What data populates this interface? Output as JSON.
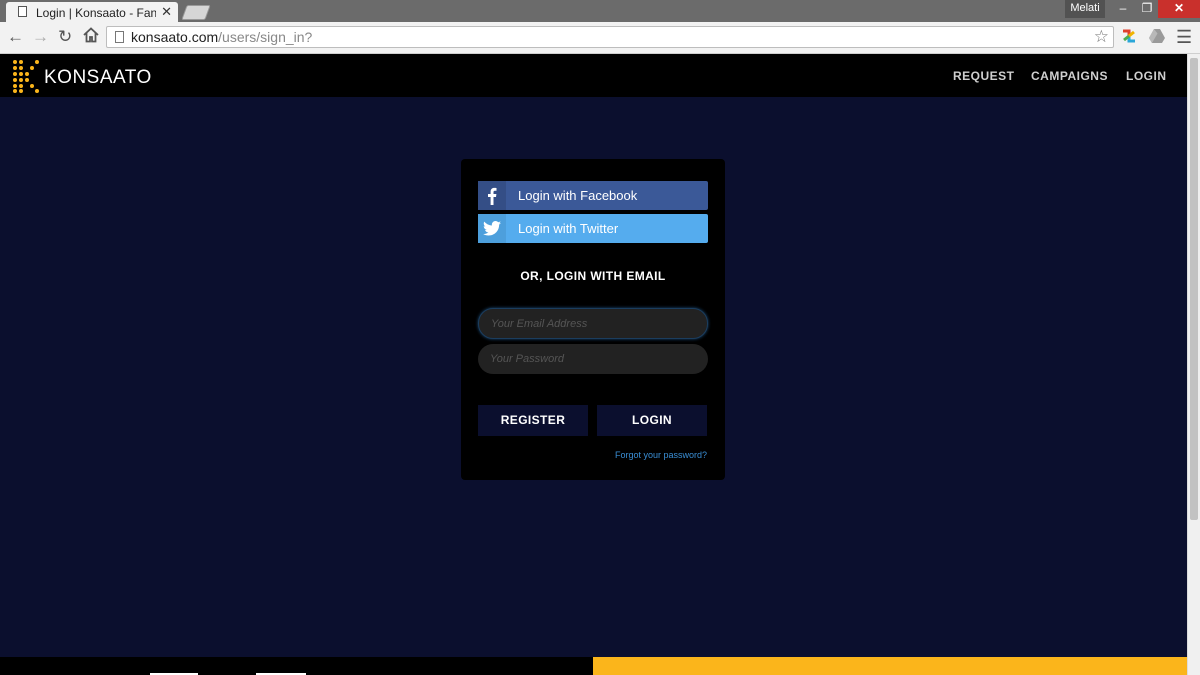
{
  "browser": {
    "tab_title": "Login | Konsaato - Fans D",
    "tab_close": "✕",
    "profile_name": "Melati",
    "url_domain": "konsaato.com",
    "url_path": "/users/sign_in?",
    "win_min": "–",
    "win_max": "❐",
    "win_close": "✕"
  },
  "site": {
    "brand": "KONSAATO",
    "nav": {
      "request": "REQUEST",
      "campaigns": "CAMPAIGNS",
      "login": "LOGIN"
    }
  },
  "login_panel": {
    "facebook_label": "Login with Facebook",
    "twitter_label": "Login with Twitter",
    "or_heading": "OR, LOGIN WITH EMAIL",
    "email_placeholder": "Your Email Address",
    "password_placeholder": "Your Password",
    "register_label": "REGISTER",
    "login_label": "LOGIN",
    "forgot_label": "Forgot your password?"
  },
  "colors": {
    "page_background": "#0b0f2e",
    "facebook": "#3b5998",
    "twitter": "#55acee",
    "brand_gold": "#fbb51b",
    "link": "#3a8fd6"
  },
  "icons": {
    "back": "arrow-left-icon",
    "forward": "arrow-right-icon",
    "reload": "reload-icon",
    "home": "home-icon",
    "bookmark": "star-icon",
    "menu": "hamburger-menu-icon",
    "facebook": "facebook-icon",
    "twitter": "twitter-icon"
  }
}
